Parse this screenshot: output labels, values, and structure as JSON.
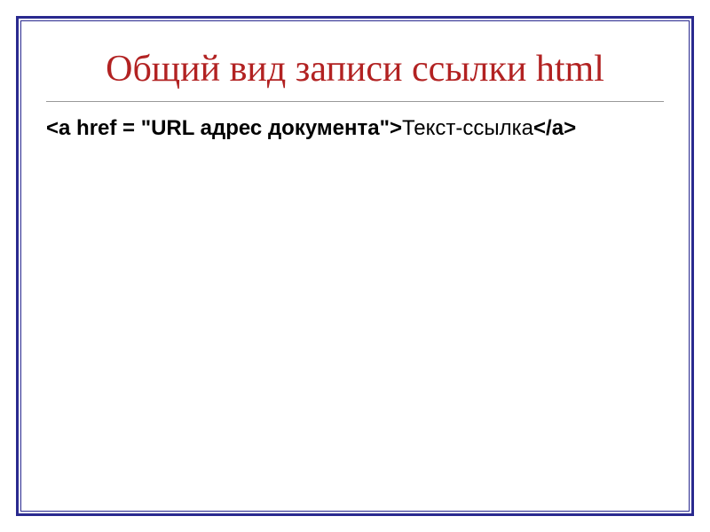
{
  "title": "Общий вид записи ссылки html",
  "code": {
    "open_tag": "<a href = \"URL адрес документа\">",
    "link_text": "Текст-ссылка",
    "close_tag": "</a>"
  }
}
